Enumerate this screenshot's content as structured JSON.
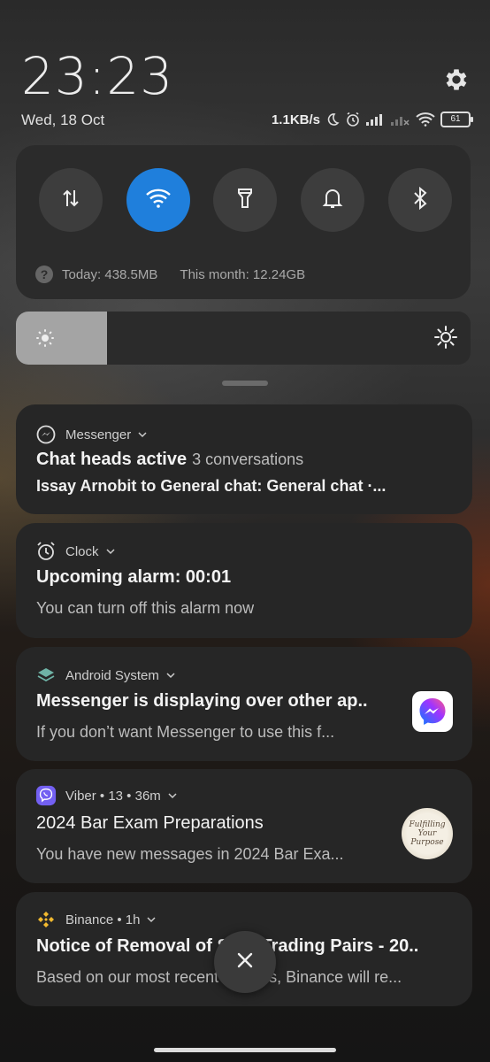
{
  "status": {
    "time": "23:23",
    "date": "Wed, 18 Oct",
    "net_speed": "1.1KB/s",
    "battery": "61"
  },
  "quick_settings": {
    "toggles": [
      {
        "name": "mobile-data",
        "icon": "data-transfer-icon",
        "active": false
      },
      {
        "name": "wifi",
        "icon": "wifi-icon",
        "active": true
      },
      {
        "name": "flashlight",
        "icon": "flashlight-icon",
        "active": false
      },
      {
        "name": "sound",
        "icon": "bell-icon",
        "active": false
      },
      {
        "name": "bluetooth",
        "icon": "bluetooth-icon",
        "active": false
      }
    ],
    "data_today": "Today: 438.5MB",
    "data_month": "This month: 12.24GB",
    "brightness_level": 0.2,
    "accent": "#1f7fdc"
  },
  "notifications": [
    {
      "app": "Messenger",
      "title": "Chat heads active",
      "title_sub": "3 conversations",
      "body": "Issay Arnobit to General chat: General chat ·..."
    },
    {
      "app": "Clock",
      "title": "Upcoming alarm: 00:01",
      "body": "You can turn off this alarm now"
    },
    {
      "app": "Android System",
      "title": "Messenger is displaying over other ap..",
      "body": "If you don’t want Messenger to use this f..."
    },
    {
      "app": "Viber • 13 • 36m",
      "title": "2024 Bar Exam Preparations",
      "body": "You have new messages in 2024 Bar Exa...",
      "thumb_text": "Fulfilling Your Purpose"
    },
    {
      "app": "Binance • 1h",
      "title": "Notice of Removal of Spot Trading Pairs - 20..",
      "body": "Based on our most recent reviews, Binance will re..."
    }
  ]
}
